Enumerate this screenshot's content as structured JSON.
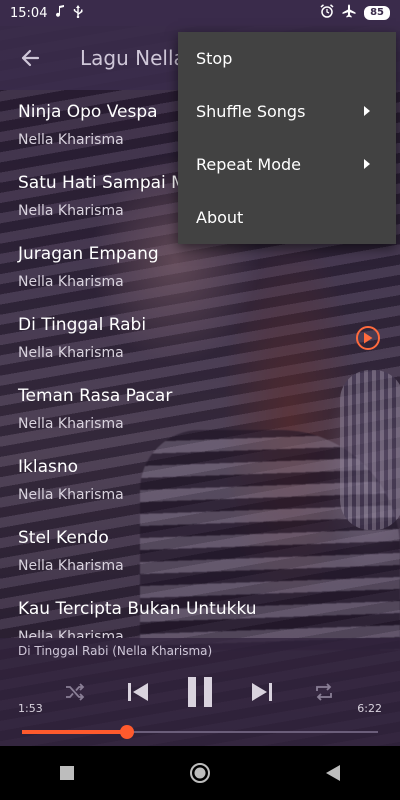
{
  "status_bar": {
    "time": "15:04",
    "left_icons": [
      "music-note-icon",
      "usb-icon"
    ],
    "right_icons": [
      "alarm-icon",
      "airplane-icon"
    ],
    "battery": "85"
  },
  "toolbar": {
    "title": "Lagu Nella Kharisma",
    "back_icon": "arrow-left-icon"
  },
  "songs": [
    {
      "title": "Ninja Opo Vespa",
      "artist": "Nella Kharisma"
    },
    {
      "title": "Satu Hati Sampai Mati",
      "artist": "Nella Kharisma"
    },
    {
      "title": "Juragan Empang",
      "artist": "Nella Kharisma"
    },
    {
      "title": "Di Tinggal Rabi",
      "artist": "Nella Kharisma",
      "playing": true
    },
    {
      "title": "Teman Rasa Pacar",
      "artist": "Nella Kharisma"
    },
    {
      "title": "Iklasno",
      "artist": "Nella Kharisma"
    },
    {
      "title": "Stel Kendo",
      "artist": "Nella Kharisma"
    },
    {
      "title": "Kau Tercipta Bukan Untukku",
      "artist": "Nella Kharisma"
    }
  ],
  "player": {
    "now_playing": "Di Tinggal Rabi (Nella Kharisma)",
    "elapsed": "1:53",
    "total": "6:22",
    "progress": 0.296,
    "icons": [
      "shuffle-icon",
      "skip-previous-icon",
      "pause-icon",
      "skip-next-icon",
      "repeat-icon"
    ]
  },
  "menu": {
    "items": [
      {
        "label": "Stop",
        "submenu": false
      },
      {
        "label": "Shuffle Songs",
        "submenu": true
      },
      {
        "label": "Repeat Mode",
        "submenu": true
      },
      {
        "label": "About",
        "submenu": false
      }
    ]
  },
  "nav_bar": {
    "icons": [
      "recents-square-icon",
      "home-circle-icon",
      "back-triangle-icon"
    ]
  },
  "colors": {
    "accent": "#ff5a2d",
    "toolbar": "#3a2b4b",
    "menu": "#424242"
  }
}
